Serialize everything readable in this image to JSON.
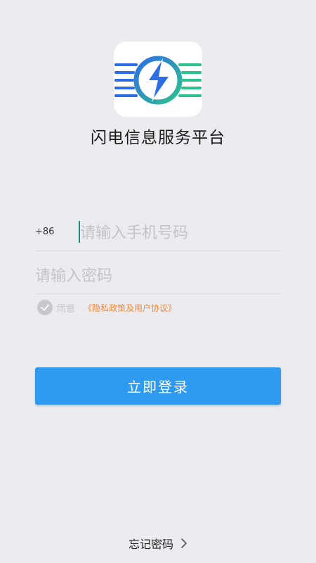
{
  "app": {
    "title": "闪电信息服务平台"
  },
  "login_form": {
    "country_code": "+86",
    "phone_placeholder": "请输入手机号码",
    "password_placeholder": "请输入密码",
    "agree_label": "同意",
    "policy_link": "《隐私政策及用户协议》",
    "login_button": "立即登录",
    "forgot_password": "忘记密码"
  },
  "colors": {
    "background": "#ececf0",
    "primary_button": "#2e9bf0",
    "policy_link": "#f08a3c",
    "caret": "#1f8a7a",
    "logo_blue": "#2d6ee6",
    "logo_green": "#2ec28d"
  },
  "icons": {
    "logo": "lightning-bolt-logo-icon",
    "agree_check": "checkmark-circle-icon",
    "forgot_arrow": "chevron-right-icon"
  }
}
